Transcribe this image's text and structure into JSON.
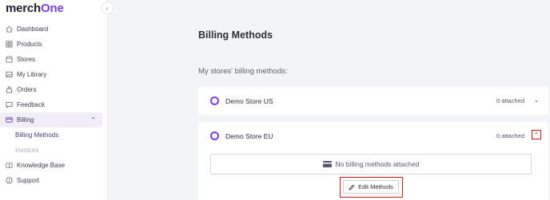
{
  "brand": {
    "name_start": "merch",
    "name_accent": "One",
    "accent_color": "#7b3fe4"
  },
  "sidebar": {
    "collapse_icon": "chevron-left-icon",
    "items": [
      {
        "label": "Dashboard",
        "icon": "home-icon"
      },
      {
        "label": "Products",
        "icon": "grid-icon"
      },
      {
        "label": "Stores",
        "icon": "store-icon"
      },
      {
        "label": "My Library",
        "icon": "image-icon"
      },
      {
        "label": "Orders",
        "icon": "bag-icon"
      },
      {
        "label": "Feedback",
        "icon": "chat-icon"
      },
      {
        "label": "Billing",
        "icon": "credit-card-icon",
        "expanded": true
      },
      {
        "label": "Knowledge Base",
        "icon": "book-icon"
      },
      {
        "label": "Support",
        "icon": "info-icon"
      }
    ],
    "billing_sub": [
      {
        "label": "Billing Methods",
        "active": true
      },
      {
        "label": "Invoices",
        "active": false
      }
    ]
  },
  "main": {
    "title": "Billing Methods",
    "section_label": "My stores' billing methods:",
    "stores": [
      {
        "name": "Demo Store US",
        "attached": "0 attached",
        "expanded": false
      },
      {
        "name": "Demo Store EU",
        "attached": "0 attached",
        "expanded": true
      }
    ],
    "empty_message": "No billing methods attached",
    "edit_button": "Edit Methods"
  },
  "colors": {
    "highlight_red": "#d01818",
    "page_bg": "#f3f4f8"
  }
}
